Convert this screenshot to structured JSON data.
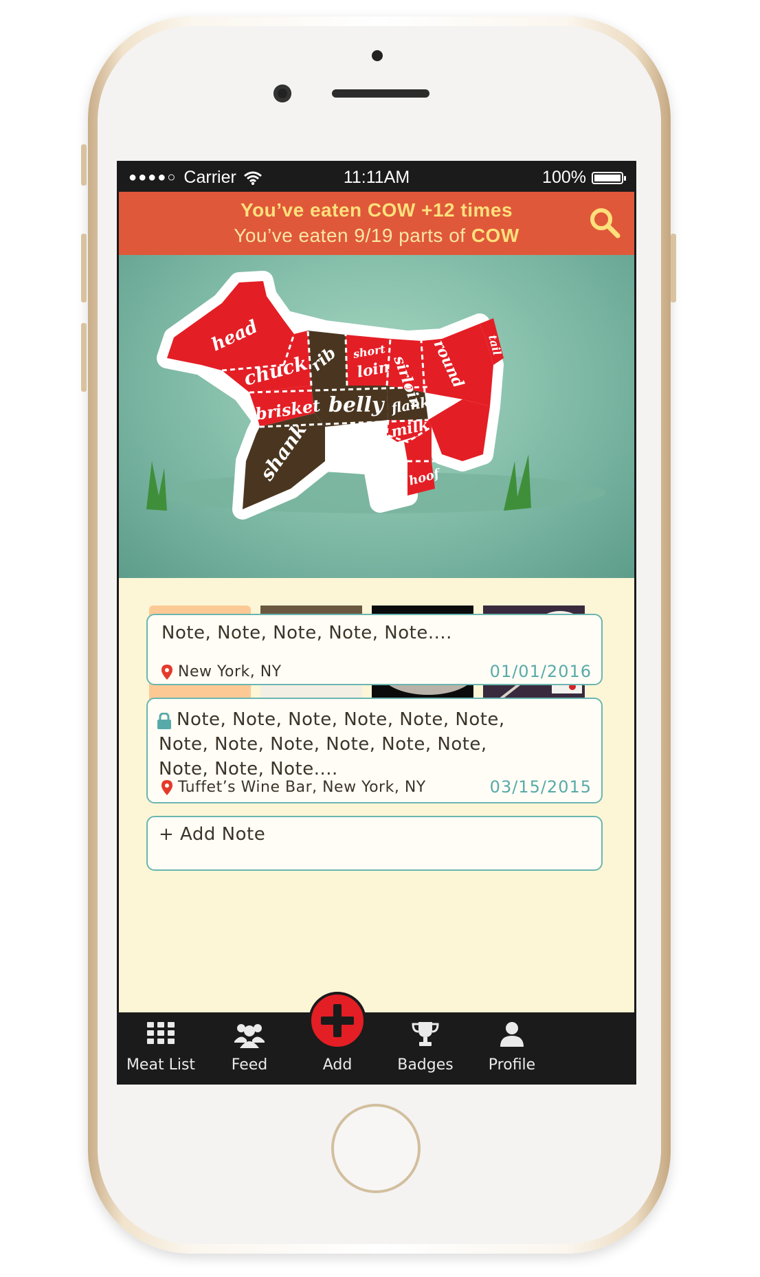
{
  "status_bar": {
    "signal": "●●●●○",
    "carrier": "Carrier",
    "time": "11:11AM",
    "battery": "100%",
    "battery_level": 1.0
  },
  "banner": {
    "line1": "You’ve eaten COW +12 times",
    "line2_prefix": "You’ve eaten 9/19 parts of ",
    "line2_animal": "COW",
    "search_icon": "search-icon"
  },
  "cow_diagram": {
    "parts": [
      "head",
      "chuck",
      "rib",
      "short loin",
      "sirloin",
      "round",
      "tail",
      "brisket",
      "belly",
      "flank",
      "shank",
      "milk",
      "hoof"
    ],
    "labels": {
      "head": "head",
      "chuck": "chuck",
      "rib": "rib",
      "short": "short",
      "loin": "loin",
      "sirloin": "sirloin",
      "round": "round",
      "tail": "tail",
      "brisket": "brisket",
      "belly": "belly",
      "flank": "flank",
      "shank": "shank",
      "milk": "milk",
      "hoof": "hoof"
    },
    "colors": {
      "eaten": "#e41e25",
      "not_eaten": "#4a3620",
      "background": "#7fbaa6"
    }
  },
  "photos": {
    "add_photo_icon": "camera-icon",
    "items": [
      "dumplings-photo",
      "sandwich-photo",
      "noodle-bowl-photo"
    ]
  },
  "notes": [
    {
      "text": "Note, Note, Note, Note, Note....",
      "location": "New York, NY",
      "date": "01/01/2016",
      "private": false
    },
    {
      "text_lines": [
        "Note, Note, Note, Note, Note, Note,",
        "Note, Note, Note, Note, Note, Note,",
        "Note, Note, Note...."
      ],
      "location": "Tuffet’s Wine Bar, New York, NY",
      "date": "03/15/2015",
      "private": true
    }
  ],
  "add_note": "+ Add Note",
  "tabs": [
    {
      "label": "Meat List",
      "icon": "grid-icon"
    },
    {
      "label": "Feed",
      "icon": "people-icon"
    },
    {
      "label": "Add",
      "icon": "plus-icon"
    },
    {
      "label": "Badges",
      "icon": "trophy-icon"
    },
    {
      "label": "Profile",
      "icon": "person-icon"
    }
  ],
  "colors": {
    "banner": "#e0583a",
    "banner_text": "#fde07c",
    "accent_teal": "#58aaa9",
    "background": "#fcf6d6",
    "tabbar": "#1b1b1b",
    "add_button": "#e41e25"
  }
}
